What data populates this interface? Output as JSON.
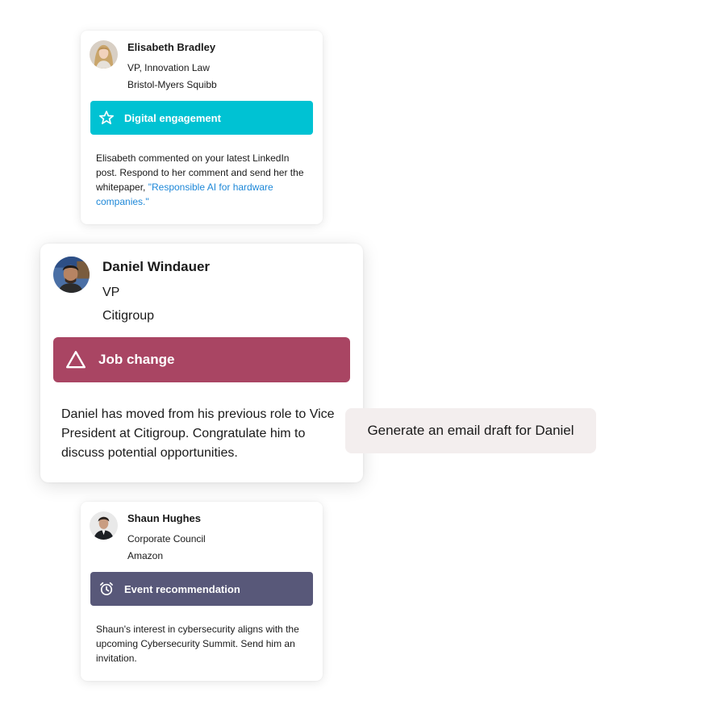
{
  "colors": {
    "digital_engagement": "#00c2d3",
    "job_change": "#a94563",
    "event_recommendation": "#585879",
    "link": "#1e88d8",
    "action_button_bg": "#f3eeee"
  },
  "cards": {
    "elisabeth": {
      "name": "Elisabeth Bradley",
      "title": "VP, Innovation Law",
      "company": "Bristol-Myers Squibb",
      "banner_label": "Digital engagement",
      "banner_icon": "star-outline-icon",
      "description": "Elisabeth commented on your latest LinkedIn post. Respond to her comment and send her the whitepaper, ",
      "description_link": "\"Responsible AI for hardware companies.\""
    },
    "daniel": {
      "name": "Daniel Windauer",
      "title": "VP",
      "company": "Citigroup",
      "banner_label": "Job change",
      "banner_icon": "triangle-outline-icon",
      "description": "Daniel has moved from his previous role to Vice President at Citigroup. Congratulate him to discuss potential opportunities."
    },
    "shaun": {
      "name": "Shaun Hughes",
      "title": "Corporate Council",
      "company": "Amazon",
      "banner_label": "Event recommendation",
      "banner_icon": "alarm-clock-icon",
      "description": "Shaun's interest in cybersecurity aligns with the upcoming Cybersecurity Summit. Send him an invitation."
    }
  },
  "action": {
    "label": "Generate an email draft for Daniel"
  }
}
